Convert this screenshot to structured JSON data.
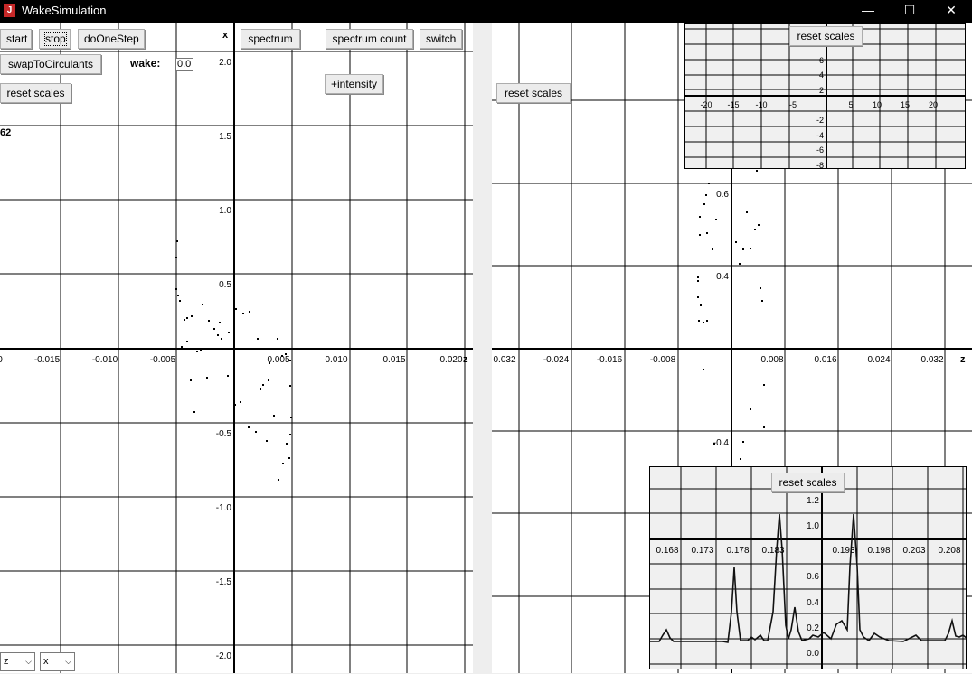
{
  "window": {
    "title": "WakeSimulation",
    "minimize": "—",
    "maximize": "☐",
    "close": "✕",
    "icon": "java-app-icon"
  },
  "left": {
    "buttons": {
      "start": "start",
      "stop": "stop",
      "do_one_step": "doOneStep",
      "spectrum": "spectrum",
      "spectrum_count": "spectrum count",
      "switch": "switch",
      "swap": "swapToCirculants",
      "reset": "reset scales",
      "intensity": "+intensity"
    },
    "wake_label": "wake:",
    "wake_value": "0.0",
    "axis_x_name": "x",
    "axis_z_name": "z",
    "partial_label": "62",
    "selects": {
      "first": "z",
      "second": "x"
    },
    "x_ticks": [
      "0",
      "-0.015",
      "-0.010",
      "-0.005",
      "0.005",
      "0.010",
      "0.015",
      "0.020"
    ],
    "y_ticks": [
      "2.0",
      "1.5",
      "1.0",
      "0.5",
      "-0.5",
      "-1.0",
      "-1.5",
      "-2.0"
    ]
  },
  "right": {
    "reset_label": "reset scales",
    "axis_z_name": "z",
    "x_ticks": [
      "0.032",
      "-0.024",
      "-0.016",
      "-0.008",
      "0.008",
      "0.016",
      "0.024",
      "0.032"
    ],
    "y_ticks": [
      "0.6",
      "0.4",
      "-0.4"
    ],
    "inset_top": {
      "reset_label": "reset scales",
      "x_ticks": [
        "-20",
        "-15",
        "-10",
        "-5",
        "5",
        "10",
        "15",
        "20"
      ],
      "y_ticks": [
        "6",
        "4",
        "2",
        "-2",
        "-4",
        "-6",
        "-8"
      ]
    },
    "inset_bottom": {
      "reset_label": "reset scales",
      "x_ticks": [
        "0.168",
        "0.173",
        "0.178",
        "0.183",
        "0.193",
        "0.198",
        "0.203",
        "0.208"
      ],
      "y_ticks": [
        "1.2",
        "1.0",
        "0.6",
        "0.4",
        "0.2",
        "0.0"
      ]
    }
  },
  "colors": {
    "background": "#ffffff",
    "frame": "#eeeeee",
    "grid": "#000000"
  }
}
